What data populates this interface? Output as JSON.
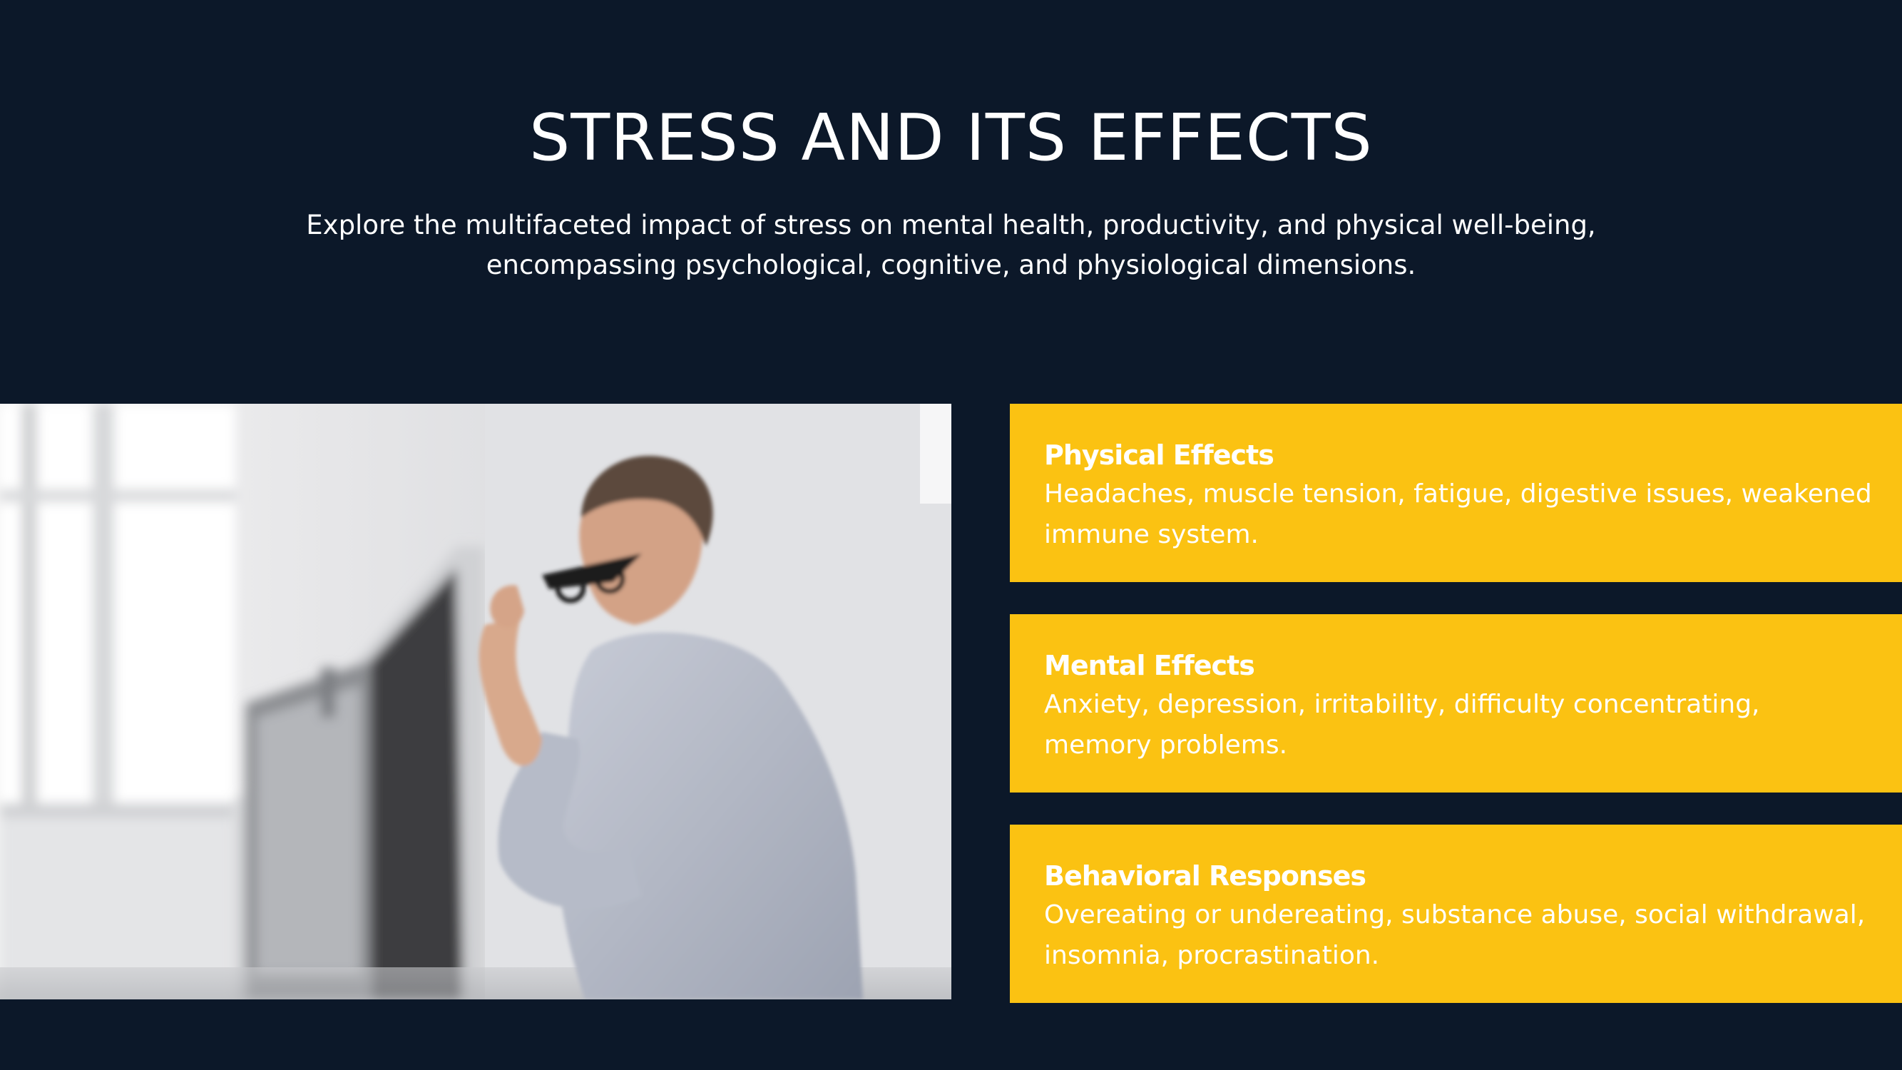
{
  "slide": {
    "title": "STRESS AND ITS EFFECTS",
    "subtitle": "Explore the multifaceted impact of stress on mental health, productivity, and physical well-being, encompassing psychological, cognitive, and physiological dimensions."
  },
  "colors": {
    "background": "#0c1829",
    "card": "#fbc212",
    "text": "#ffffff"
  },
  "cards": [
    {
      "title": "Physical Effects",
      "text": "Headaches, muscle tension, fatigue, digestive issues, weakened immune system."
    },
    {
      "title": "Mental Effects",
      "text": "Anxiety, depression, irritability, difficulty concentrating, memory problems."
    },
    {
      "title": "Behavioral Responses",
      "text": "Overeating or undereating, substance abuse, social withdrawal, insomnia, procrastination."
    }
  ]
}
